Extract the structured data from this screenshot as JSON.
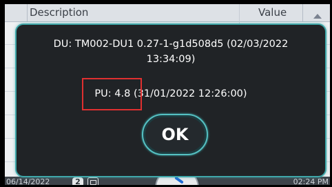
{
  "table": {
    "columns": [
      "Description",
      "Value"
    ]
  },
  "dialog": {
    "du_line1": "DU: TM002-DU1 0.27-1-g1d508d5 (02/03/2022",
    "du_line2": "13:34:09)",
    "pu_line": "PU: 4.8 (31/01/2022 12:26:00)",
    "ok_label": "OK"
  },
  "statusbar": {
    "date": "06/14/2022",
    "badge_count": "2",
    "time": "02:24 PM",
    "icon": "calendar-icon"
  },
  "colors": {
    "dialog_border": "#3fa7a9",
    "highlight": "#e03030"
  }
}
